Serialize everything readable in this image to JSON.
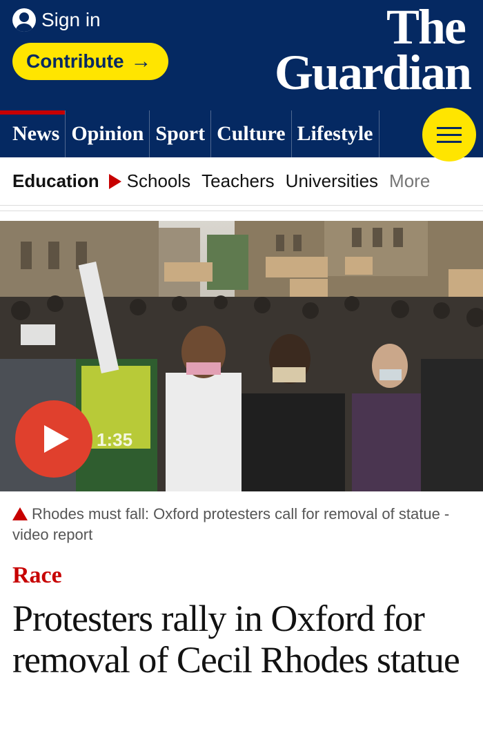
{
  "header": {
    "sign_in": "Sign in",
    "contribute": "Contribute",
    "contribute_arrow": "→",
    "logo_line1": "The",
    "logo_line2": "Guardian"
  },
  "nav": {
    "pillars": [
      {
        "label": "News",
        "active": true
      },
      {
        "label": "Opinion"
      },
      {
        "label": "Sport"
      },
      {
        "label": "Culture"
      },
      {
        "label": "Lifestyle"
      }
    ],
    "menu_icon": "hamburger-icon"
  },
  "subnav": {
    "section": "Education",
    "links": [
      "Schools",
      "Teachers",
      "Universities"
    ],
    "more": "More"
  },
  "media": {
    "duration": "1:35",
    "play_icon": "play-icon"
  },
  "caption": "Rhodes must fall: Oxford protesters call for removal of statue - video report",
  "article": {
    "kicker": "Race",
    "headline": "Protesters rally in Oxford for removal of Cecil Rhodes statue"
  },
  "colors": {
    "brand_blue": "#052962",
    "accent_yellow": "#ffe500",
    "news_red": "#c70000",
    "play_orange": "#e0402d"
  }
}
